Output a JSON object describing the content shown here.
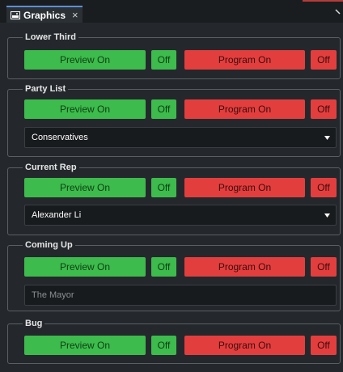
{
  "tab": {
    "title": "Graphics",
    "close_glyph": "×",
    "icon": "image-icon"
  },
  "groups": [
    {
      "title": "Lower Third",
      "preview_label": "Preview On",
      "preview_off_label": "Off",
      "program_label": "Program On",
      "program_off_label": "Off"
    },
    {
      "title": "Party List",
      "preview_label": "Preview On",
      "preview_off_label": "Off",
      "program_label": "Program On",
      "program_off_label": "Off",
      "select_value": "Conservatives"
    },
    {
      "title": "Current Rep",
      "preview_label": "Preview On",
      "preview_off_label": "Off",
      "program_label": "Program On",
      "program_off_label": "Off",
      "select_value": "Alexander Li"
    },
    {
      "title": "Coming Up",
      "preview_label": "Preview On",
      "preview_off_label": "Off",
      "program_label": "Program On",
      "program_off_label": "Off",
      "input_value": "The Mayor"
    },
    {
      "title": "Bug",
      "preview_label": "Preview On",
      "preview_off_label": "Off",
      "program_label": "Program On",
      "program_off_label": "Off"
    }
  ],
  "colors": {
    "preview_green": "#3dbb4c",
    "program_red": "#e33e3e",
    "background": "#24282c"
  }
}
